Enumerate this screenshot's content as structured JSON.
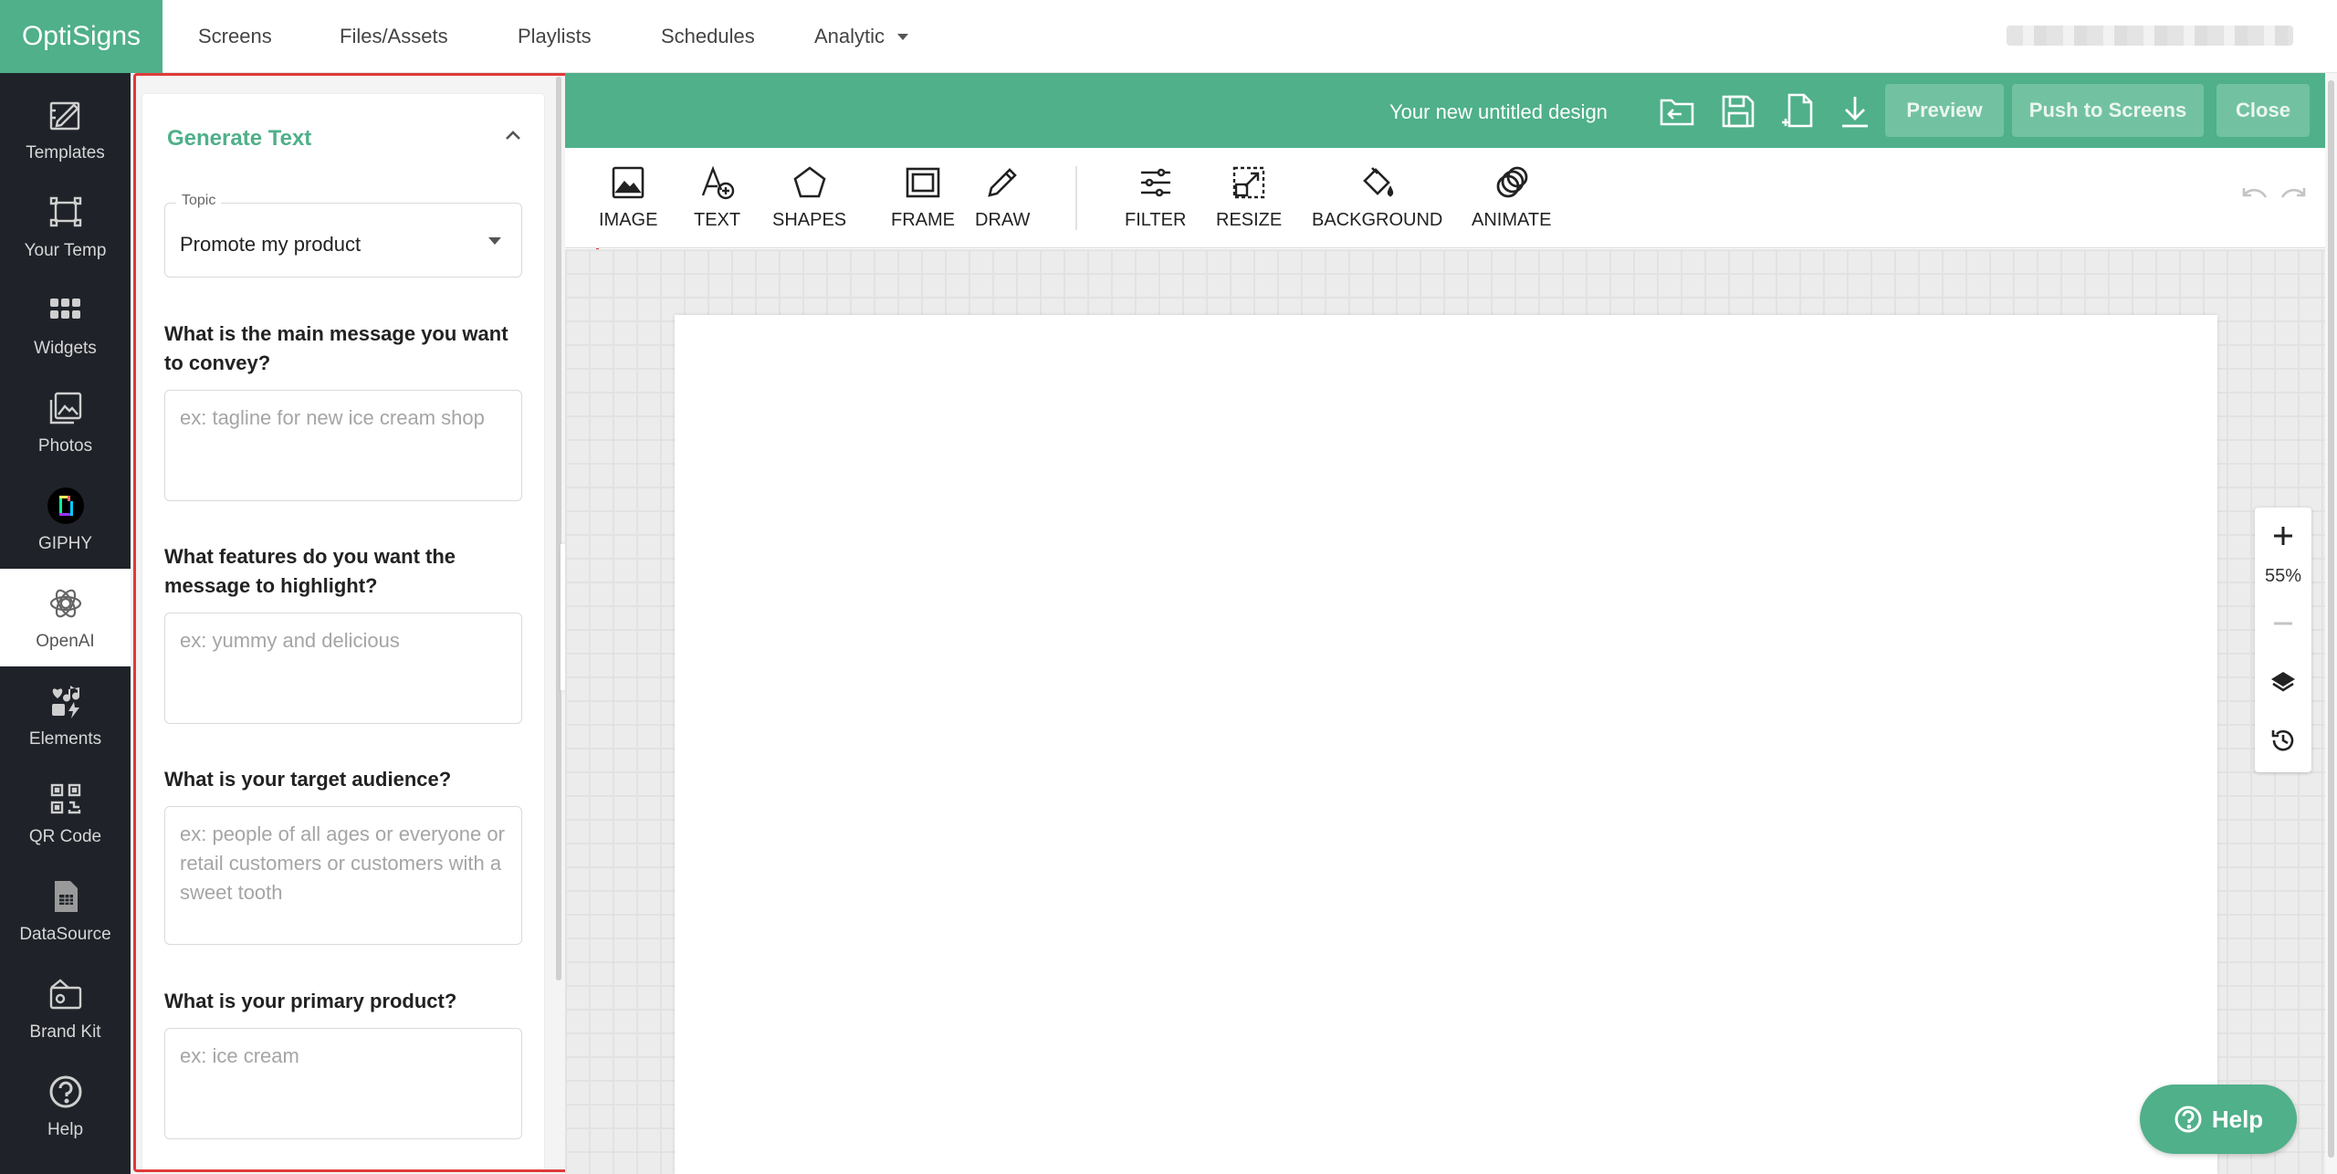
{
  "app": {
    "logo": "OptiSigns"
  },
  "nav": {
    "items": [
      "Screens",
      "Files/Assets",
      "Playlists",
      "Schedules",
      "Analytic"
    ]
  },
  "sidebar": {
    "items": [
      {
        "label": "Templates",
        "icon": "templates-icon"
      },
      {
        "label": "Your Temp",
        "icon": "your-templates-icon"
      },
      {
        "label": "Widgets",
        "icon": "widgets-icon"
      },
      {
        "label": "Photos",
        "icon": "photos-icon"
      },
      {
        "label": "GIPHY",
        "icon": "giphy-icon"
      },
      {
        "label": "OpenAI",
        "icon": "openai-icon"
      },
      {
        "label": "Elements",
        "icon": "elements-icon"
      },
      {
        "label": "QR Code",
        "icon": "qr-code-icon"
      },
      {
        "label": "DataSource",
        "icon": "datasource-icon"
      },
      {
        "label": "Brand Kit",
        "icon": "brand-kit-icon"
      },
      {
        "label": "Help",
        "icon": "help-icon"
      }
    ],
    "active": "OpenAI"
  },
  "panel": {
    "title": "Generate Text",
    "topic": {
      "label": "Topic",
      "value": "Promote my product"
    },
    "questions": [
      {
        "label": "What is the main message you want to convey?",
        "placeholder": "ex: tagline for new ice cream shop",
        "value": ""
      },
      {
        "label": "What features do you want the message to highlight?",
        "placeholder": "ex: yummy and delicious",
        "value": ""
      },
      {
        "label": "What is your target audience?",
        "placeholder": "ex: people of all ages or everyone or retail customers or customers with a sweet tooth",
        "value": ""
      },
      {
        "label": "What is your primary product?",
        "placeholder": "ex: ice cream",
        "value": ""
      }
    ]
  },
  "design": {
    "title": "Your new untitled design",
    "buttons": {
      "preview": "Preview",
      "push": "Push to Screens",
      "close": "Close"
    }
  },
  "toolbar": {
    "tools": [
      "IMAGE",
      "TEXT",
      "SHAPES",
      "FRAME",
      "DRAW",
      "FILTER",
      "RESIZE",
      "BACKGROUND",
      "ANIMATE"
    ]
  },
  "zoom": {
    "level": "55%"
  },
  "help": {
    "label": "Help"
  },
  "colors": {
    "brand": "#4fb08a",
    "sidebar": "#1f2329",
    "highlight": "#e03a3a",
    "button": "#72c2a2"
  }
}
